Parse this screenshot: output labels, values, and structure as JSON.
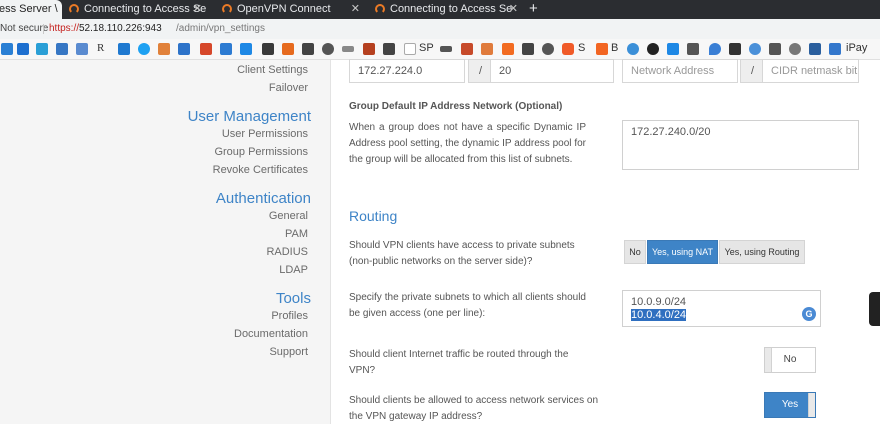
{
  "browser": {
    "tabs": [
      {
        "title": "ess Server \\"
      },
      {
        "title": "Connecting to Access Se"
      },
      {
        "title": "OpenVPN Connect"
      },
      {
        "title": "Connecting to Access Se"
      }
    ],
    "new_tab": "+",
    "address": {
      "security": "Not secure",
      "scheme": "https://",
      "host": "52.18.110.226:943",
      "path": "/admin/vpn_settings"
    },
    "bookmarks": [
      "R",
      "SP",
      "S",
      "B",
      "iPay"
    ]
  },
  "sidebar": {
    "top_links": [
      "Client Settings",
      "Failover"
    ],
    "user_management": {
      "heading": "User Management",
      "links": [
        "User Permissions",
        "Group Permissions",
        "Revoke Certificates"
      ]
    },
    "authentication": {
      "heading": "Authentication",
      "links": [
        "General",
        "PAM",
        "RADIUS",
        "LDAP"
      ]
    },
    "tools": {
      "heading": "Tools",
      "links": [
        "Profiles",
        "Documentation",
        "Support"
      ]
    }
  },
  "main": {
    "static_net": {
      "address": "172.27.224.0",
      "slash": "/",
      "bits": "20"
    },
    "dynamic_net": {
      "address_placeholder": "Network Address",
      "slash": "/",
      "bits_placeholder": "CIDR netmask bit"
    },
    "group_default": {
      "title": "Group Default IP Address Network (Optional)",
      "description": "When a group does not have a specific Dynamic IP Address pool setting, the dynamic IP address pool for the group will be allocated from this list of subnets.",
      "value": "172.27.240.0/20"
    },
    "routing": {
      "title": "Routing",
      "private_access": {
        "question": "Should VPN clients have access to private subnets (non-public networks on the server side)?",
        "options": [
          "No",
          "Yes, using NAT",
          "Yes, using Routing"
        ],
        "selected": "Yes, using NAT"
      },
      "subnets": {
        "question": "Specify the private subnets to which all clients should be given access (one per line):",
        "lines": [
          "10.0.9.0/24",
          "10.0.4.0/24"
        ]
      },
      "internet_traffic": {
        "question": "Should client Internet traffic be routed through the VPN?",
        "value": "No"
      },
      "gateway_services": {
        "question": "Should clients be allowed to access network services on the VPN gateway IP address?",
        "value": "Yes"
      }
    }
  },
  "colors": {
    "accent": "#3e84c7",
    "sidebar_bg": "#f5f5f5"
  }
}
